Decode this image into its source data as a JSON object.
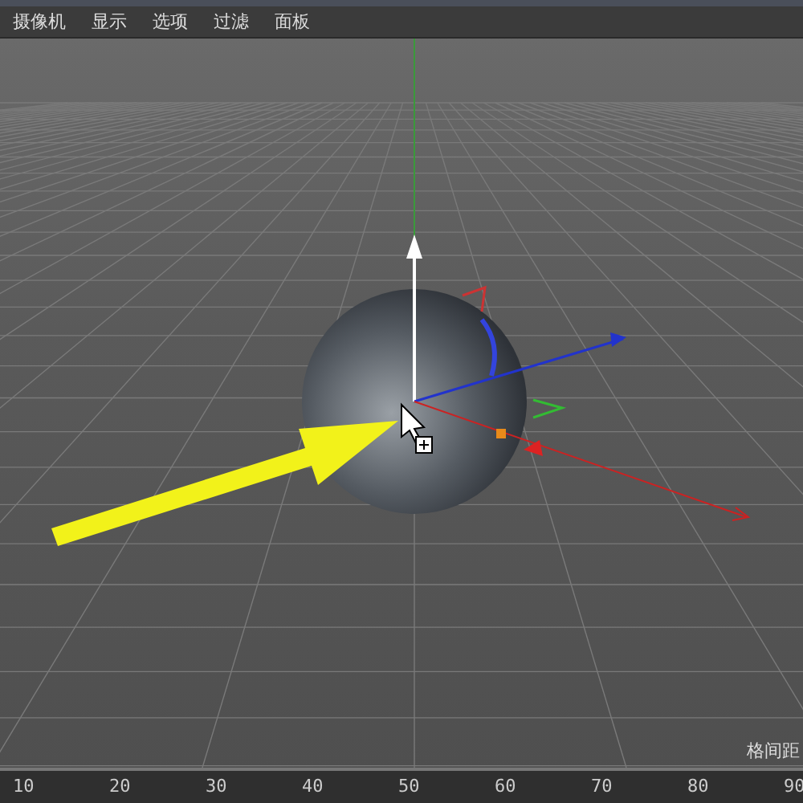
{
  "menu": [
    {
      "label": "摄像机"
    },
    {
      "label": "显示"
    },
    {
      "label": "选项"
    },
    {
      "label": "过滤"
    },
    {
      "label": "面板"
    }
  ],
  "viewport": {
    "corner_text": "格间距"
  },
  "timeline": {
    "labels": [
      "10",
      "20",
      "30",
      "40",
      "50",
      "60",
      "70",
      "80",
      "90"
    ]
  }
}
